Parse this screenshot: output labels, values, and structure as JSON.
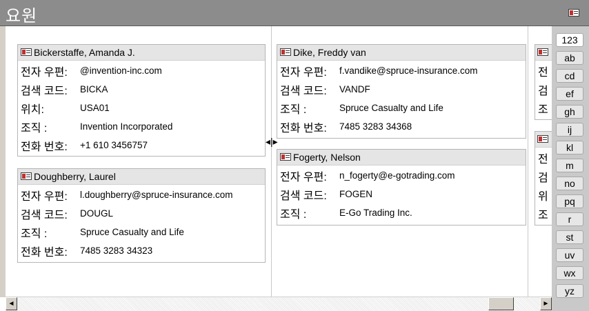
{
  "window": {
    "title": "요원",
    "icon": "contact-card-icon"
  },
  "cards": [
    {
      "name": "Bickerstaffe, Amanda J.",
      "rows": [
        {
          "label": "전자 우편:",
          "value": "@invention-inc.com"
        },
        {
          "label": "검색 코드:",
          "value": "BICKA"
        },
        {
          "label": "위치:",
          "value": "USA01"
        },
        {
          "label": "조직 :",
          "value": "Invention Incorporated"
        },
        {
          "label": "전화 번호:",
          "value": "+1 610 3456757"
        }
      ]
    },
    {
      "name": "Doughberry, Laurel",
      "rows": [
        {
          "label": "전자 우편:",
          "value": "l.doughberry@spruce-insurance.com"
        },
        {
          "label": "검색 코드:",
          "value": "DOUGL"
        },
        {
          "label": "조직 :",
          "value": "Spruce Casualty and Life"
        },
        {
          "label": "전화 번호:",
          "value": "7485 3283 34323"
        }
      ]
    },
    {
      "name": "Dike, Freddy van",
      "rows": [
        {
          "label": "전자 우편:",
          "value": "f.vandike@spruce-insurance.com"
        },
        {
          "label": "검색 코드:",
          "value": "VANDF"
        },
        {
          "label": "조직 :",
          "value": "Spruce Casualty and Life"
        },
        {
          "label": "전화 번호:",
          "value": "7485 3283 34368"
        }
      ]
    },
    {
      "name": "Fogerty, Nelson",
      "rows": [
        {
          "label": "전자 우편:",
          "value": "n_fogerty@e-gotrading.com"
        },
        {
          "label": "검색 코드:",
          "value": "FOGEN"
        },
        {
          "label": "조직 :",
          "value": "E-Go Trading Inc."
        }
      ]
    },
    {
      "partial_labels": [
        "전",
        "검",
        "조"
      ]
    },
    {
      "partial_labels": [
        "전",
        "검",
        "위",
        "조"
      ]
    }
  ],
  "index_tabs": [
    "123",
    "ab",
    "cd",
    "ef",
    "gh",
    "ij",
    "kl",
    "m",
    "no",
    "pq",
    "r",
    "st",
    "uv",
    "wx",
    "yz"
  ],
  "scrollbar": {
    "left_arrow": "◄",
    "right_arrow": "►"
  },
  "cursor_glyph": "◂|▸"
}
